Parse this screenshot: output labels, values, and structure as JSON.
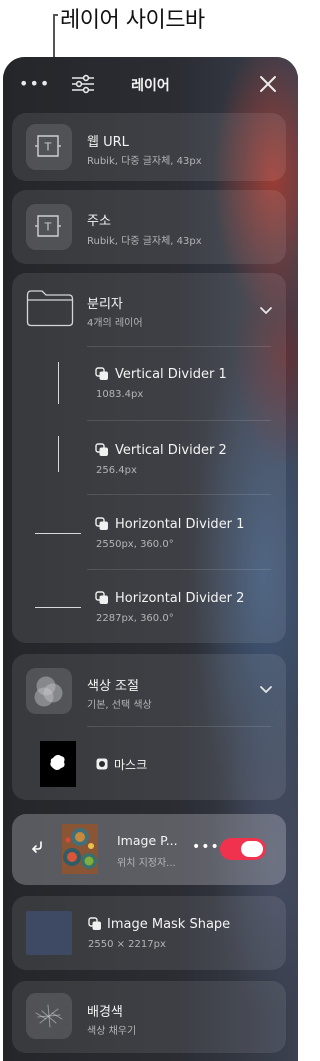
{
  "callout": {
    "title": "레이어 사이드바"
  },
  "header": {
    "title": "레이어",
    "more_label": "•••"
  },
  "layers": {
    "web_url": {
      "title": "웹 URL",
      "subtitle": "Rubik, 다중 글자체, 43px"
    },
    "address": {
      "title": "주소",
      "subtitle": "Rubik, 다중 글자체, 43px"
    },
    "divider_group": {
      "title": "분리자",
      "subtitle": "4개의 레이어",
      "children": [
        {
          "title": "Vertical Divider 1",
          "subtitle": "1083.4px"
        },
        {
          "title": "Vertical Divider 2",
          "subtitle": "256.4px"
        },
        {
          "title": "Horizontal Divider 1",
          "subtitle": "2550px, 360.0°"
        },
        {
          "title": "Horizontal Divider 2",
          "subtitle": "2287px, 360.0°"
        }
      ]
    },
    "color_adjust": {
      "title": "색상 조절",
      "subtitle": "기본, 선택 색상",
      "mask_label": "마스크"
    },
    "image_placeholder": {
      "title": "Image P...",
      "subtitle": "위치 지정자...",
      "more_label": "•••",
      "toggle_on": true
    },
    "image_mask_shape": {
      "title": "Image Mask Shape",
      "subtitle": "2550 × 2217px"
    },
    "background": {
      "title": "배경색",
      "subtitle": "색상 채우기"
    }
  },
  "colors": {
    "toggle_on": "#f0324f",
    "panel_bg": "#2a2b2e"
  }
}
